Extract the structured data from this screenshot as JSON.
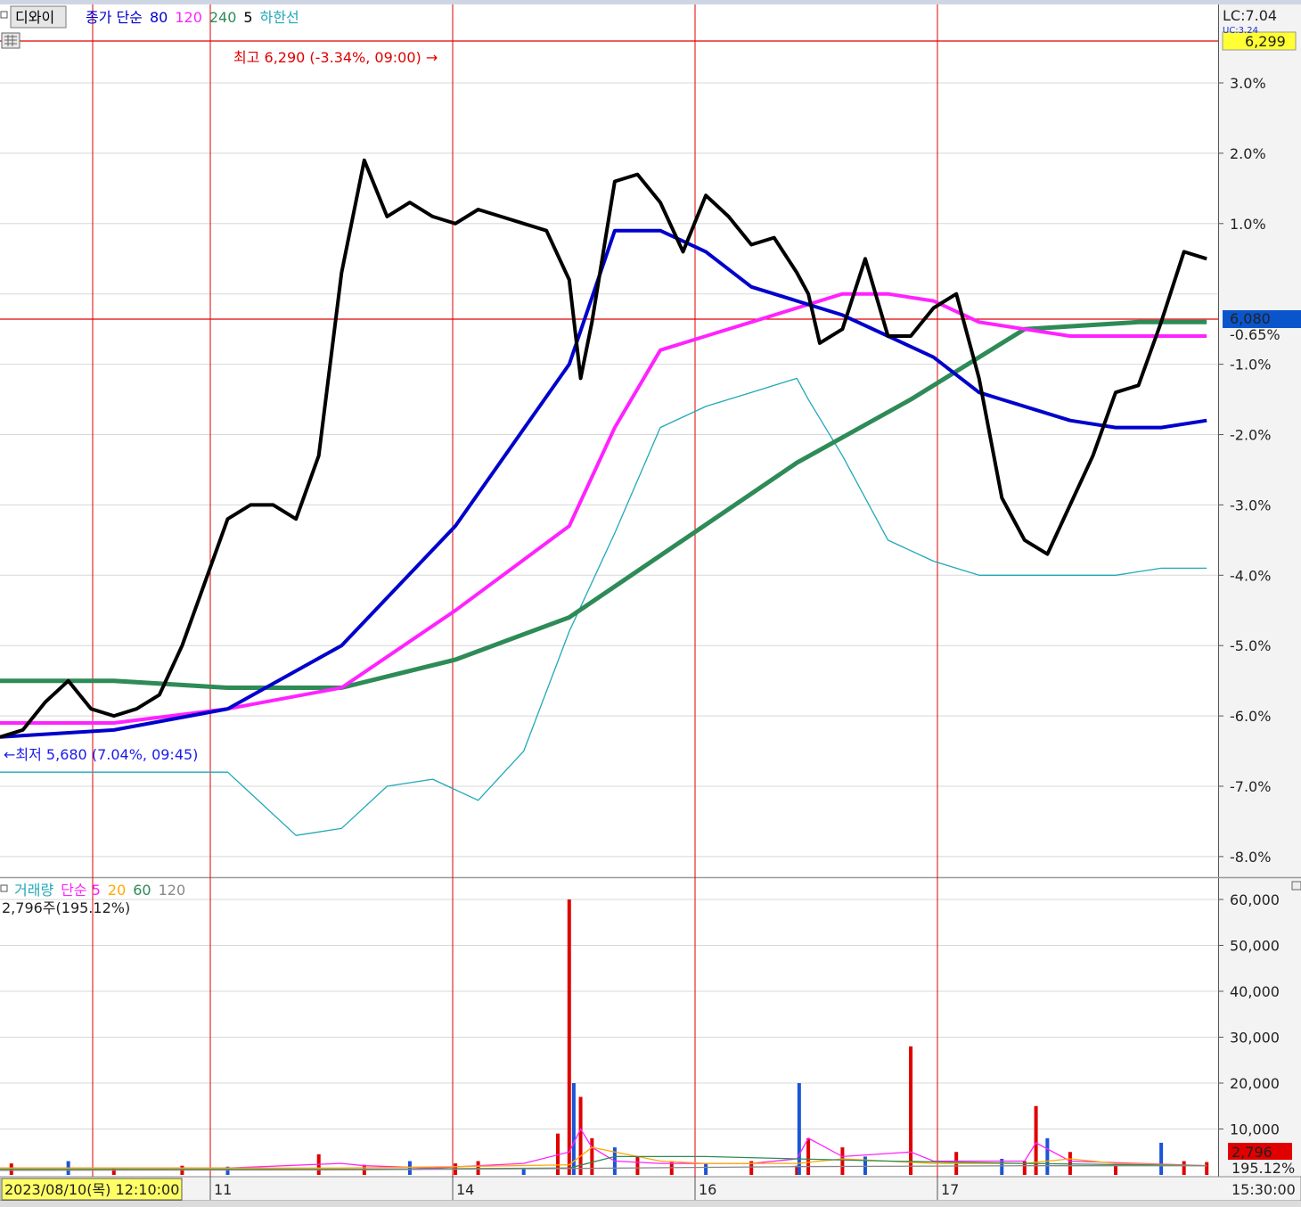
{
  "price_panel": {
    "symbol_button": "디와이",
    "legend": [
      {
        "text": "종가 단순",
        "color": "#0000cc"
      },
      {
        "text": "80",
        "color": "#0000cc"
      },
      {
        "text": "120",
        "color": "#ff22ff"
      },
      {
        "text": "240",
        "color": "#2e8b57"
      },
      {
        "text": "5",
        "color": "#000000"
      },
      {
        "text": "하한선",
        "color": "#20a8b8"
      }
    ],
    "lc_label": "LC:7.04",
    "uc_label": "UC:3.24",
    "max_price_tag": "6,299",
    "current_price_tag": "6,080",
    "current_pct_tag": "-0.65%",
    "high_annotation": "최고 6,290 (-3.34%, 09:00) →",
    "low_annotation": "←최저 5,680 (7.04%, 09:45)"
  },
  "volume_panel": {
    "legend": [
      {
        "text": "거래량",
        "color": "#20a8b8"
      },
      {
        "text": "단순 5",
        "color": "#ff22ff"
      },
      {
        "text": "20",
        "color": "#ffaa00"
      },
      {
        "text": "60",
        "color": "#2e8b57"
      },
      {
        "text": "120",
        "color": "#888888"
      }
    ],
    "info": "2,796주(195.12%)",
    "current_volume_tag": "2,796",
    "current_pct_tag": "195.12%"
  },
  "time_axis": {
    "cursor_label": "2023/08/10(목) 12:10:00",
    "end_time": "15:30:00"
  },
  "chart_data": [
    {
      "type": "line",
      "title": "",
      "y_unit": "% (right axis)",
      "y_ticks": [
        "3.0%",
        "2.0%",
        "1.0%",
        "-1.0%",
        "-2.0%",
        "-3.0%",
        "-4.0%",
        "-5.0%",
        "-6.0%",
        "-7.0%",
        "-8.0%"
      ],
      "ylim": [
        -8.2,
        3.5
      ],
      "x_ticks": [
        "11",
        "14",
        "16",
        "17"
      ],
      "day_boundaries": [
        0.0,
        0.5,
        1.0,
        2.0,
        3.0,
        4.0
      ],
      "xlim": [
        -0.5,
        4.85
      ],
      "high_line_pct": 3.6,
      "current_line_pct": -0.65,
      "series": [
        {
          "name": "5",
          "color": "#000000",
          "width": 4,
          "x": [
            -0.5,
            -0.4,
            -0.3,
            -0.2,
            -0.1,
            0.0,
            0.1,
            0.2,
            0.3,
            0.4,
            0.5,
            0.6,
            0.7,
            0.8,
            0.9,
            1.0,
            1.1,
            1.2,
            1.3,
            1.4,
            1.5,
            1.6,
            1.7,
            1.8,
            1.9,
            2.0,
            2.05,
            2.1,
            2.2,
            2.3,
            2.4,
            2.5,
            2.6,
            2.7,
            2.8,
            2.9,
            3.0,
            3.05,
            3.1,
            3.2,
            3.3,
            3.4,
            3.5,
            3.6,
            3.7,
            3.8,
            3.9,
            4.0,
            4.1,
            4.2,
            4.3,
            4.4,
            4.5,
            4.6,
            4.7,
            4.8
          ],
          "y": [
            -6.3,
            -6.2,
            -5.8,
            -5.5,
            -5.9,
            -6.0,
            -5.9,
            -5.7,
            -5.0,
            -4.1,
            -3.2,
            -3.0,
            -3.0,
            -3.2,
            -2.3,
            0.3,
            1.9,
            1.1,
            1.3,
            1.1,
            1.0,
            1.2,
            1.1,
            1.0,
            0.9,
            0.2,
            -1.2,
            -0.4,
            1.6,
            1.7,
            1.3,
            0.6,
            1.4,
            1.1,
            0.7,
            0.8,
            0.3,
            0.0,
            -0.7,
            -0.5,
            0.5,
            -0.6,
            -0.6,
            -0.2,
            0.0,
            -1.2,
            -2.9,
            -3.5,
            -3.7,
            -3.0,
            -2.3,
            -1.4,
            -1.3,
            -0.4,
            0.6,
            0.5
          ]
        },
        {
          "name": "80",
          "color": "#0000cc",
          "width": 4,
          "x": [
            -0.5,
            0.0,
            0.5,
            1.0,
            1.5,
            2.0,
            2.2,
            2.4,
            2.6,
            2.8,
            3.0,
            3.2,
            3.4,
            3.6,
            3.8,
            3.9,
            4.0,
            4.2,
            4.4,
            4.6,
            4.8
          ],
          "y": [
            -6.3,
            -6.2,
            -5.9,
            -5.0,
            -3.3,
            -1.0,
            0.9,
            0.9,
            0.6,
            0.1,
            -0.1,
            -0.3,
            -0.6,
            -0.9,
            -1.4,
            -1.5,
            -1.6,
            -1.8,
            -1.9,
            -1.9,
            -1.8
          ]
        },
        {
          "name": "120",
          "color": "#ff22ff",
          "width": 4,
          "x": [
            -0.5,
            0.0,
            0.5,
            1.0,
            1.5,
            2.0,
            2.2,
            2.4,
            2.6,
            2.8,
            3.0,
            3.2,
            3.4,
            3.6,
            3.8,
            4.0,
            4.2,
            4.4,
            4.6,
            4.8
          ],
          "y": [
            -6.1,
            -6.1,
            -5.9,
            -5.6,
            -4.5,
            -3.3,
            -1.9,
            -0.8,
            -0.6,
            -0.4,
            -0.2,
            0.0,
            0.0,
            -0.1,
            -0.4,
            -0.5,
            -0.6,
            -0.6,
            -0.6,
            -0.6
          ]
        },
        {
          "name": "240",
          "color": "#2e8b57",
          "width": 5,
          "x": [
            -0.5,
            0.0,
            0.5,
            1.0,
            1.5,
            2.0,
            2.5,
            3.0,
            3.5,
            4.0,
            4.5,
            4.8
          ],
          "y": [
            -5.5,
            -5.5,
            -5.6,
            -5.6,
            -5.2,
            -4.6,
            -3.5,
            -2.4,
            -1.5,
            -0.5,
            -0.4,
            -0.4
          ]
        },
        {
          "name": "하한선",
          "color": "#20a8b8",
          "width": 1.3,
          "x": [
            -0.5,
            0.0,
            0.2,
            0.4,
            0.5,
            0.6,
            0.8,
            1.0,
            1.2,
            1.4,
            1.6,
            1.8,
            2.0,
            2.2,
            2.4,
            2.6,
            2.8,
            3.0,
            3.05,
            3.2,
            3.4,
            3.6,
            3.8,
            4.0,
            4.2,
            4.4,
            4.6,
            4.8
          ],
          "y": [
            -6.8,
            -6.8,
            -6.8,
            -6.8,
            -6.8,
            -7.1,
            -7.7,
            -7.6,
            -7.0,
            -6.9,
            -7.2,
            -6.5,
            -4.8,
            -3.4,
            -1.9,
            -1.6,
            -1.4,
            -1.2,
            -1.5,
            -2.3,
            -3.5,
            -3.8,
            -4.0,
            -4.0,
            -4.0,
            -4.0,
            -3.9,
            -3.9
          ]
        }
      ]
    },
    {
      "type": "bar",
      "title": "",
      "y_ticks": [
        "60,000",
        "50,000",
        "40,000",
        "30,000",
        "20,000",
        "10,000"
      ],
      "ylim": [
        0,
        64000
      ],
      "x": [
        -0.45,
        -0.2,
        0.0,
        0.3,
        0.5,
        0.9,
        1.1,
        1.3,
        1.5,
        1.6,
        1.8,
        1.95,
        2.0,
        2.02,
        2.05,
        2.1,
        2.2,
        2.3,
        2.45,
        2.6,
        2.8,
        3.0,
        3.01,
        3.05,
        3.2,
        3.3,
        3.5,
        3.7,
        3.9,
        4.0,
        4.05,
        4.1,
        4.2,
        4.4,
        4.6,
        4.7,
        4.8
      ],
      "values": [
        2500,
        3000,
        1500,
        2000,
        1800,
        4500,
        2200,
        3000,
        2500,
        3000,
        1500,
        9000,
        60000,
        20000,
        17000,
        8000,
        6000,
        4000,
        3000,
        2500,
        3000,
        2000,
        20000,
        8000,
        6000,
        4000,
        28000,
        5000,
        3500,
        3000,
        15000,
        8000,
        5000,
        2000,
        7000,
        3000,
        2796
      ],
      "colors_note": "red = up, blue = down",
      "ma_lines": [
        {
          "name": "단순 5",
          "color": "#ff22ff",
          "x": [
            -0.5,
            0.0,
            0.5,
            1.0,
            1.1,
            1.4,
            1.8,
            2.0,
            2.05,
            2.1,
            2.2,
            2.4,
            2.8,
            3.0,
            3.05,
            3.2,
            3.5,
            3.6,
            4.0,
            4.05,
            4.2,
            4.5,
            4.8
          ],
          "y": [
            1500,
            1500,
            1500,
            2500,
            2000,
            1500,
            2500,
            5000,
            10000,
            6000,
            3000,
            2500,
            2500,
            3500,
            8000,
            4000,
            5000,
            3000,
            3000,
            7000,
            3000,
            2500,
            2000
          ]
        },
        {
          "name": "20",
          "color": "#ffaa00",
          "x": [
            -0.5,
            0.0,
            1.0,
            1.5,
            2.0,
            2.1,
            2.2,
            2.4,
            2.6,
            3.0,
            3.2,
            3.4,
            3.6,
            4.0,
            4.2,
            4.4,
            4.8
          ],
          "y": [
            1500,
            1500,
            1500,
            1800,
            2200,
            6000,
            5000,
            3000,
            2500,
            2500,
            3500,
            3000,
            2500,
            2500,
            3500,
            2500,
            2000
          ]
        },
        {
          "name": "60",
          "color": "#2e8b57",
          "x": [
            -0.5,
            1.0,
            2.0,
            2.2,
            2.6,
            3.0,
            3.4,
            4.0,
            4.5,
            4.8
          ],
          "y": [
            1200,
            1200,
            1500,
            4000,
            4000,
            3500,
            3000,
            2500,
            2200,
            2000
          ]
        },
        {
          "name": "120",
          "color": "#888888",
          "x": [
            -0.5,
            1.0,
            2.0,
            3.0,
            4.0,
            4.8
          ],
          "y": [
            1000,
            1100,
            1400,
            1800,
            2000,
            2000
          ]
        }
      ]
    }
  ]
}
